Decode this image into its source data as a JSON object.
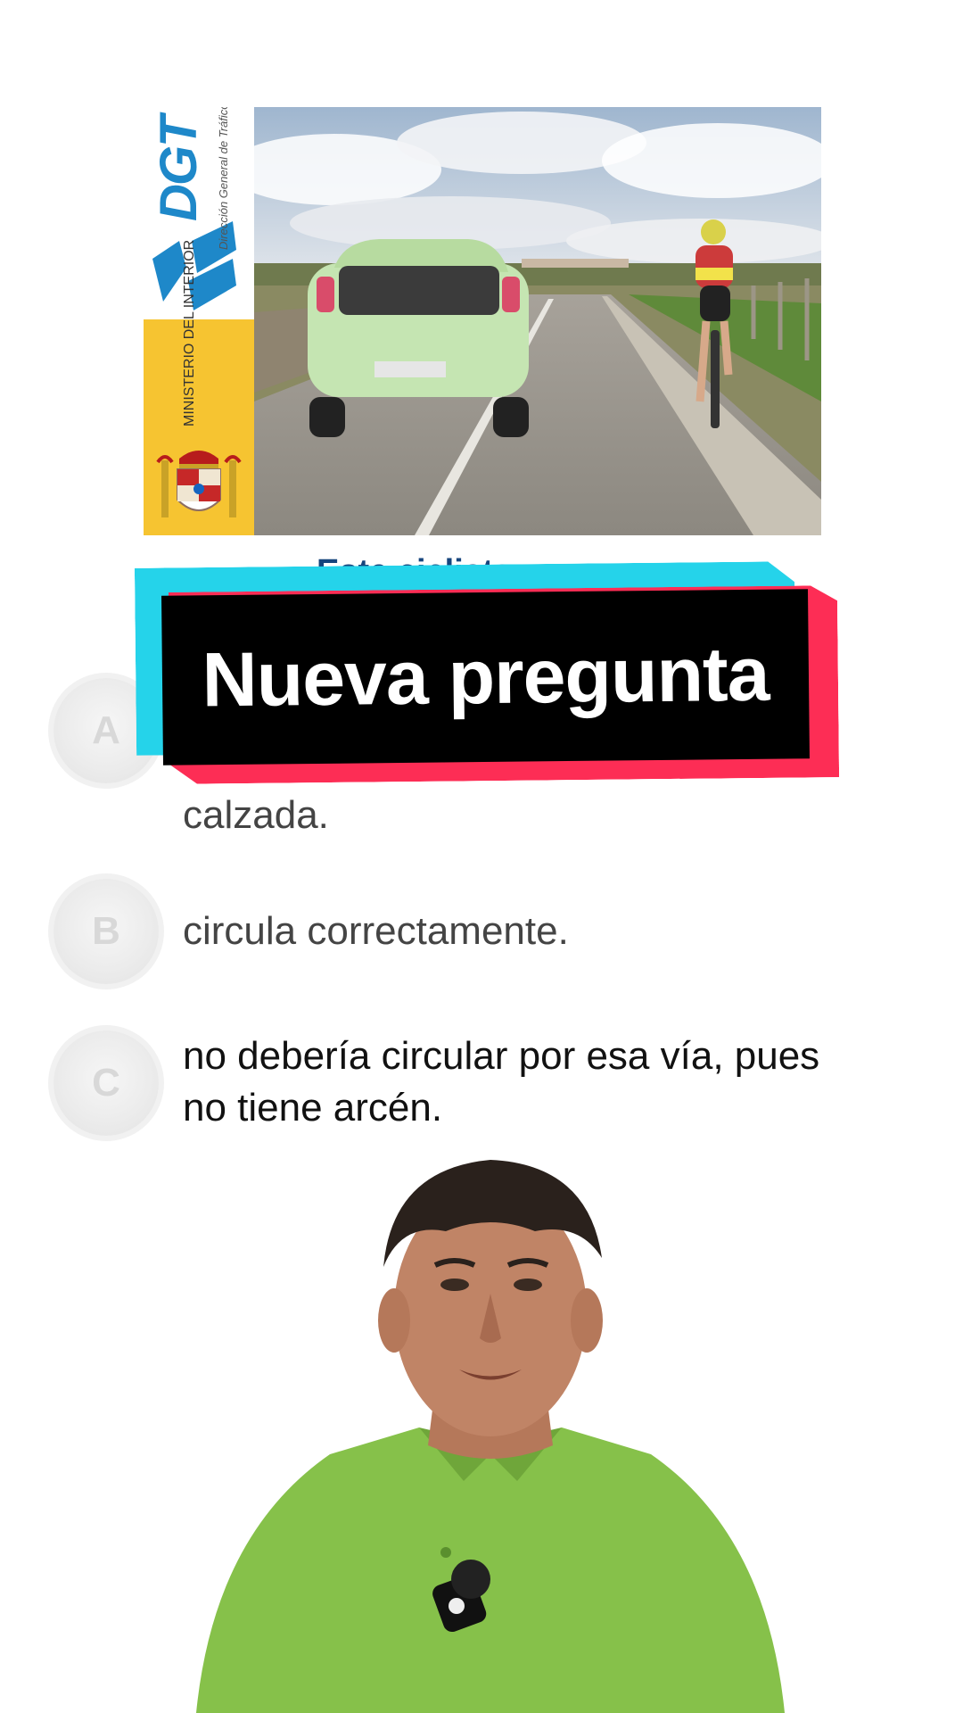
{
  "illustration": {
    "logo_text": "DGT",
    "agency_name": "Dirección General de Tráfico",
    "ministry_name": "MINISTERIO DEL INTERIOR",
    "scene": "car-and-cyclist-on-rural-road"
  },
  "question": {
    "fragment": "Este ciclista"
  },
  "banner": {
    "label": "Nueva pregunta",
    "colors": {
      "cyan": "#25d3ea",
      "red": "#fd2d55",
      "fill": "#000000",
      "text": "#ffffff"
    }
  },
  "options": [
    {
      "letter": "A",
      "text": "calzada."
    },
    {
      "letter": "B",
      "text": "circula correctamente."
    },
    {
      "letter": "C",
      "text": "no debería circular por esa vía, pues no tiene arcén."
    }
  ],
  "presenter": {
    "shirt_color": "#8bc34a"
  }
}
